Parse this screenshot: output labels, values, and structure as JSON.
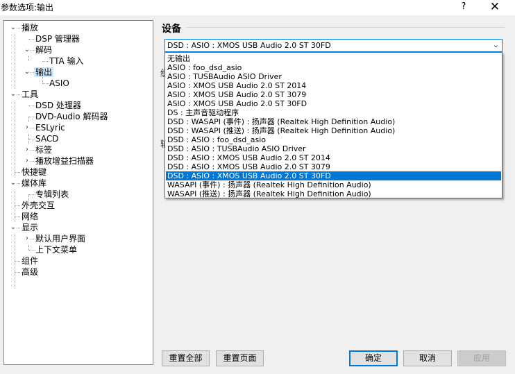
{
  "window": {
    "title": "参数选项:输出",
    "help": "?",
    "close": "✕"
  },
  "tree": {
    "nodes": [
      {
        "label": "播放",
        "toggle": "⌄"
      },
      {
        "label": "DSP 管理器",
        "toggle": ""
      },
      {
        "label": "解码",
        "toggle": "⌄"
      },
      {
        "label": "TTA 输入",
        "toggle": ""
      },
      {
        "label": "输出",
        "toggle": "⌄",
        "selected": true
      },
      {
        "label": "ASIO",
        "toggle": ""
      },
      {
        "label": "工具",
        "toggle": "⌄"
      },
      {
        "label": "DSD 处理器",
        "toggle": ""
      },
      {
        "label": "DVD-Audio 解码器",
        "toggle": ""
      },
      {
        "label": "ESLyric",
        "toggle": "›"
      },
      {
        "label": "SACD",
        "toggle": ""
      },
      {
        "label": "标签",
        "toggle": "›"
      },
      {
        "label": "播放增益扫描器",
        "toggle": "›"
      },
      {
        "label": "快捷键",
        "toggle": ""
      },
      {
        "label": "媒体库",
        "toggle": "⌄"
      },
      {
        "label": "专辑列表",
        "toggle": ""
      },
      {
        "label": "外壳交互",
        "toggle": ""
      },
      {
        "label": "网络",
        "toggle": ""
      },
      {
        "label": "显示",
        "toggle": "⌄"
      },
      {
        "label": "默认用户界面",
        "toggle": "›"
      },
      {
        "label": "上下文菜单",
        "toggle": ""
      },
      {
        "label": "组件",
        "toggle": ""
      },
      {
        "label": "高级",
        "toggle": ""
      }
    ]
  },
  "device": {
    "section_title": "设备",
    "selected_value": "DSD : ASIO : XMOS USB Audio 2.0 ST 30FD",
    "options": [
      "无输出",
      "ASIO : foo_dsd_asio",
      "ASIO : TUSBAudio ASIO Driver",
      "ASIO : XMOS USB Audio 2.0 ST 2014",
      "ASIO : XMOS USB Audio 2.0 ST 3079",
      "ASIO : XMOS USB Audio 2.0 ST 30FD",
      "DS : 主声音驱动程序",
      "DSD : WASAPI (事件) : 扬声器 (Realtek High Definition Audio)",
      "DSD : WASAPI (推送) : 扬声器 (Realtek High Definition Audio)",
      "DSD : ASIO : foo_dsd_asio",
      "DSD : ASIO : TUSBAudio ASIO Driver",
      "DSD : ASIO : XMOS USB Audio 2.0 ST 2014",
      "DSD : ASIO : XMOS USB Audio 2.0 ST 3079",
      "DSD : ASIO : XMOS USB Audio 2.0 ST 30FD",
      "WASAPI (事件) : 扬声器 (Realtek High Definition Audio)",
      "WASAPI (推送) : 扬声器 (Realtek High Definition Audio)"
    ],
    "highlighted_index": 13
  },
  "buttons": {
    "reset_all": "重置全部",
    "reset_page": "重置页面",
    "ok": "确定",
    "cancel": "取消",
    "apply": "应用"
  },
  "colors": {
    "selection": "#0078d7",
    "tree_selection": "#cce8ff"
  }
}
